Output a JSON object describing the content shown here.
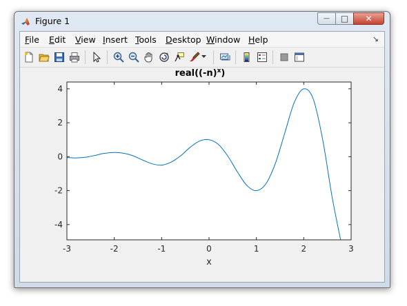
{
  "window": {
    "title": "Figure 1"
  },
  "caption_buttons": {
    "minimize": "—",
    "maximize": "□",
    "close": "✕"
  },
  "menu": {
    "items": [
      {
        "label": "File",
        "accel": "F",
        "rest": "ile"
      },
      {
        "label": "Edit",
        "accel": "E",
        "rest": "dit"
      },
      {
        "label": "View",
        "accel": "V",
        "rest": "iew"
      },
      {
        "label": "Insert",
        "accel": "I",
        "rest": "nsert"
      },
      {
        "label": "Tools",
        "accel": "T",
        "rest": "ools"
      },
      {
        "label": "Desktop",
        "accel": "D",
        "rest": "esktop"
      },
      {
        "label": "Window",
        "accel": "W",
        "rest": "indow"
      },
      {
        "label": "Help",
        "accel": "H",
        "rest": "elp"
      }
    ],
    "dock_arrow": "↘"
  },
  "toolbar": {
    "icons": [
      "new-figure-icon",
      "open-file-icon",
      "save-icon",
      "print-icon",
      "edit-plot-arrow-icon",
      "zoom-in-icon",
      "zoom-out-icon",
      "pan-hand-icon",
      "rotate-3d-icon",
      "data-cursor-icon",
      "brush-icon",
      "brush-dropdown-icon",
      "link-plot-icon",
      "insert-colorbar-icon",
      "insert-legend-icon",
      "hide-plot-tools-icon",
      "show-plot-tools-icon"
    ]
  },
  "colors": {
    "line": "#0072bd",
    "axes_bg": "#ffffff",
    "figure_bg": "#f0f0f0",
    "axis": "#262626"
  },
  "chart_data": {
    "type": "line",
    "title": "real((-n)",
    "title_superscript": "x",
    "title_suffix": ")",
    "xlabel": "x",
    "ylabel": "",
    "xlim": [
      -3,
      3
    ],
    "ylim": [
      -4.9,
      4.4
    ],
    "xticks": [
      -3,
      -2,
      -1,
      0,
      1,
      2,
      3
    ],
    "xtick_labels": [
      "-3",
      "-2",
      "-1",
      "0",
      "1",
      "2",
      "3"
    ],
    "yticks": [
      -4,
      -2,
      0,
      2,
      4
    ],
    "ytick_labels": [
      "-4",
      "-2",
      "0",
      "2",
      "4"
    ],
    "grid": false,
    "series": [
      {
        "x": [
          -3,
          -2.8,
          -2.6,
          -2.4,
          -2.2,
          -2.0,
          -1.8,
          -1.6,
          -1.4,
          -1.2,
          -1.0,
          -0.8,
          -0.6,
          -0.4,
          -0.2,
          0.0,
          0.2,
          0.4,
          0.6,
          0.8,
          1.0,
          1.2,
          1.4,
          1.6,
          1.8,
          2.0,
          2.2,
          2.4,
          2.6,
          2.8
        ],
        "y": [
          -0.05,
          -0.07,
          -0.03,
          0.08,
          0.2,
          0.25,
          0.2,
          0.05,
          -0.2,
          -0.42,
          -0.5,
          -0.32,
          0.05,
          0.55,
          0.92,
          1.0,
          0.72,
          0.02,
          -0.9,
          -1.7,
          -2.0,
          -1.6,
          -0.4,
          1.4,
          3.2,
          4.0,
          3.4,
          1.0,
          -2.4,
          -5.2
        ]
      }
    ]
  }
}
